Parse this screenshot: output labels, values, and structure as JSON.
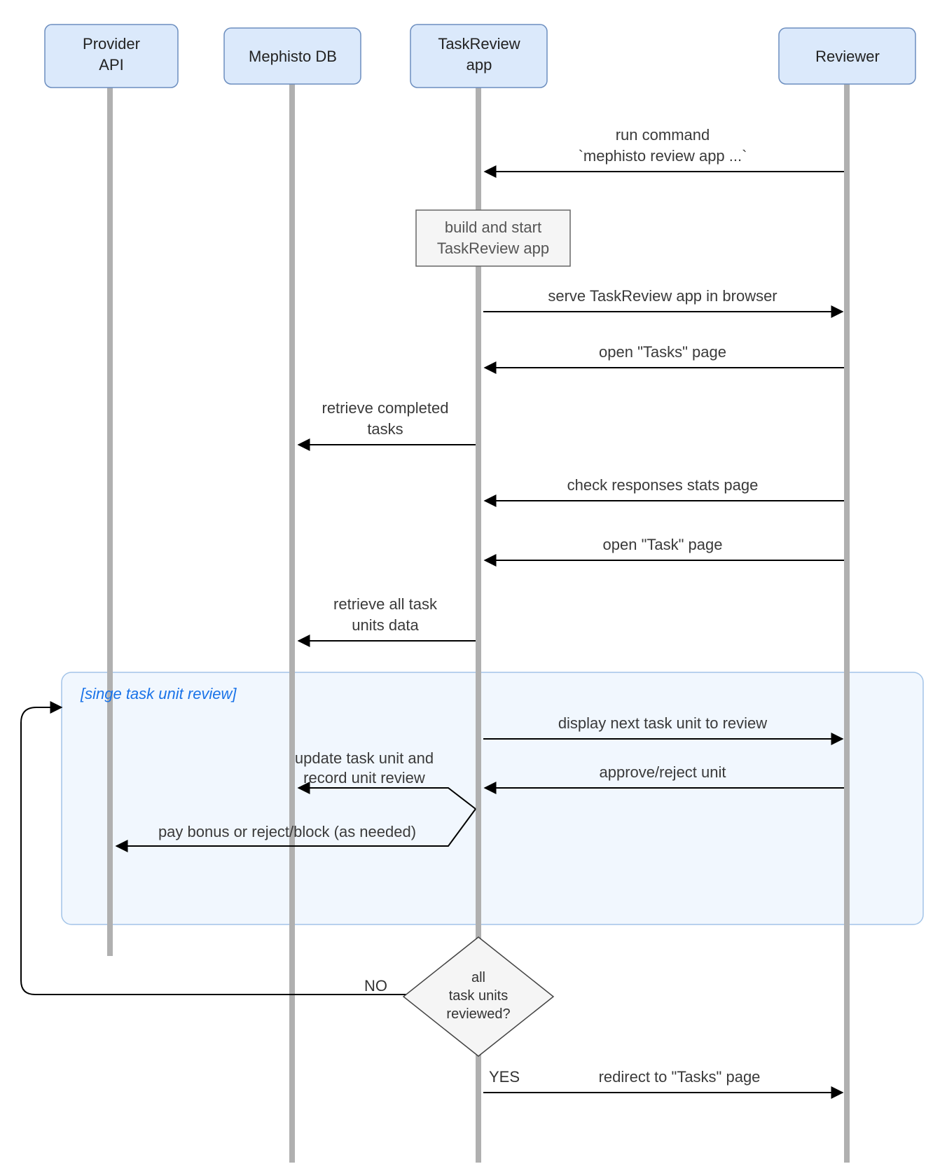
{
  "actors": {
    "provider": {
      "label_l1": "Provider",
      "label_l2": "API"
    },
    "db": {
      "label_l1": "Mephisto DB",
      "label_l2": ""
    },
    "app": {
      "label_l1": "TaskReview",
      "label_l2": "app"
    },
    "reviewer": {
      "label_l1": "Reviewer",
      "label_l2": ""
    }
  },
  "messages": {
    "m1_l1": "run command",
    "m1_l2": "`mephisto review app ...`",
    "note_l1": "build and start",
    "note_l2": "TaskReview app",
    "m2": "serve TaskReview app in browser",
    "m3": "open \"Tasks\" page",
    "m4_l1": "retrieve completed",
    "m4_l2": "tasks",
    "m5": "check responses stats page",
    "m6": "open \"Task\" page",
    "m7_l1": "retrieve all task",
    "m7_l2": "units data",
    "loop_title": "[singe task unit review]",
    "m8": "display next task unit to review",
    "m9": "approve/reject unit",
    "m10_l1": "update task unit and",
    "m10_l2": "record unit review",
    "m11": "pay bonus or reject/block (as needed)",
    "decision_l1": "all",
    "decision_l2": "task units",
    "decision_l3": "reviewed?",
    "branch_no": "NO",
    "branch_yes": "YES",
    "m12": "redirect to \"Tasks\" page"
  }
}
